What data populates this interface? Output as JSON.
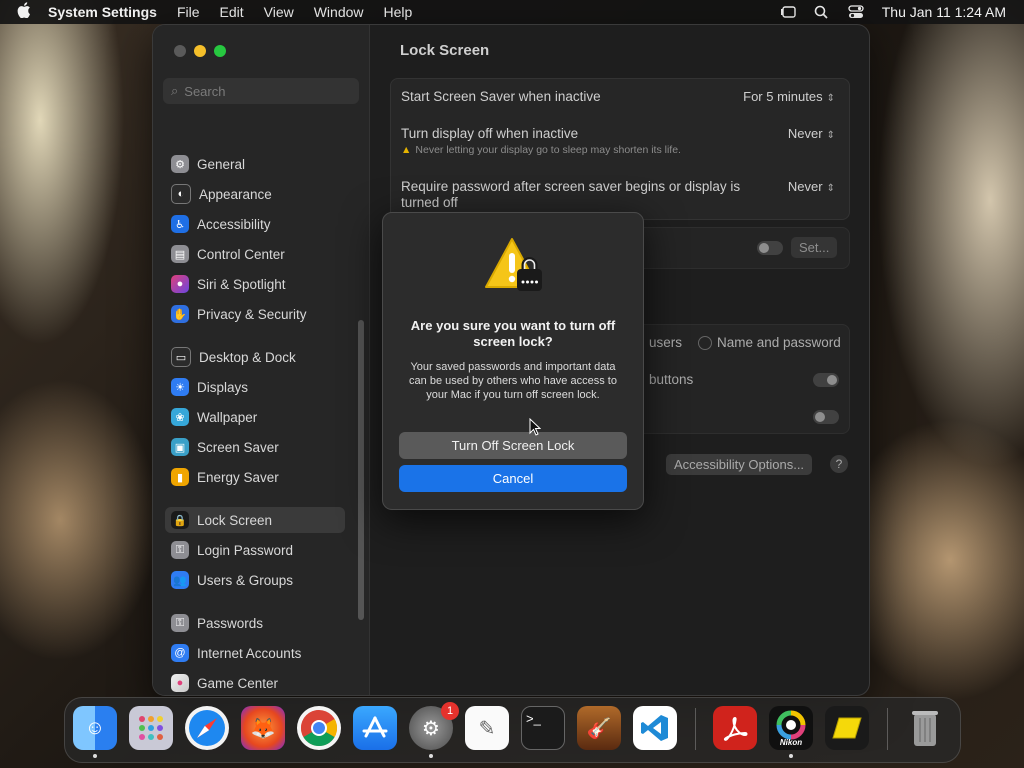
{
  "menubar": {
    "app_name": "System Settings",
    "items": [
      "File",
      "Edit",
      "View",
      "Window",
      "Help"
    ],
    "clock": "Thu Jan 11  1:24 AM"
  },
  "sidebar": {
    "search_placeholder": "Search",
    "items": [
      {
        "label": "General",
        "icon": "gear-icon",
        "color": "#8e8e93"
      },
      {
        "label": "Appearance",
        "icon": "appearance-icon",
        "color": "#2b2b2b"
      },
      {
        "label": "Accessibility",
        "icon": "accessibility-icon",
        "color": "#1f6fe5"
      },
      {
        "label": "Control Center",
        "icon": "control-center-icon",
        "color": "#8e8e93"
      },
      {
        "label": "Siri & Spotlight",
        "icon": "siri-icon",
        "color": "#b04ad6"
      },
      {
        "label": "Privacy & Security",
        "icon": "hand-icon",
        "color": "#2f6fe0"
      },
      {
        "label": "Desktop & Dock",
        "icon": "dock-icon",
        "color": "#2b2b2b"
      },
      {
        "label": "Displays",
        "icon": "displays-icon",
        "color": "#2f7cf2"
      },
      {
        "label": "Wallpaper",
        "icon": "wallpaper-icon",
        "color": "#36a7d9"
      },
      {
        "label": "Screen Saver",
        "icon": "screen-saver-icon",
        "color": "#3aa0c8"
      },
      {
        "label": "Energy Saver",
        "icon": "battery-icon",
        "color": "#f0a500"
      },
      {
        "label": "Lock Screen",
        "icon": "lock-icon",
        "color": "#2b2b2b"
      },
      {
        "label": "Login Password",
        "icon": "key-icon",
        "color": "#8e8e93"
      },
      {
        "label": "Users & Groups",
        "icon": "users-icon",
        "color": "#2f7cf2"
      },
      {
        "label": "Passwords",
        "icon": "key-icon",
        "color": "#8e8e93"
      },
      {
        "label": "Internet Accounts",
        "icon": "at-icon",
        "color": "#2f7cf2"
      },
      {
        "label": "Game Center",
        "icon": "game-center-icon",
        "color": "#e0e0e0"
      }
    ]
  },
  "main": {
    "title": "Lock Screen",
    "rows": {
      "screen_saver_label": "Start Screen Saver when inactive",
      "screen_saver_value": "For 5 minutes",
      "display_off_label": "Turn display off when inactive",
      "display_off_value": "Never",
      "display_off_warning": "Never letting your display go to sleep may shorten its life.",
      "require_password_label": "Require password after screen saver begins or display is turned off",
      "require_password_value": "Never",
      "set_button": "Set...",
      "users_partial": "users",
      "name_and_password": "Name and password",
      "buttons_partial": "buttons",
      "accessibility_options": "Accessibility Options...",
      "help": "?"
    }
  },
  "alert": {
    "title": "Are you sure you want to turn off screen lock?",
    "message": "Your saved passwords and important data can be used by others who have access to your Mac if you turn off screen lock.",
    "primary_button": "Cancel",
    "secondary_button": "Turn Off Screen Lock"
  },
  "dock": {
    "system_settings_badge": "1",
    "nikon_label": "Nikon"
  }
}
